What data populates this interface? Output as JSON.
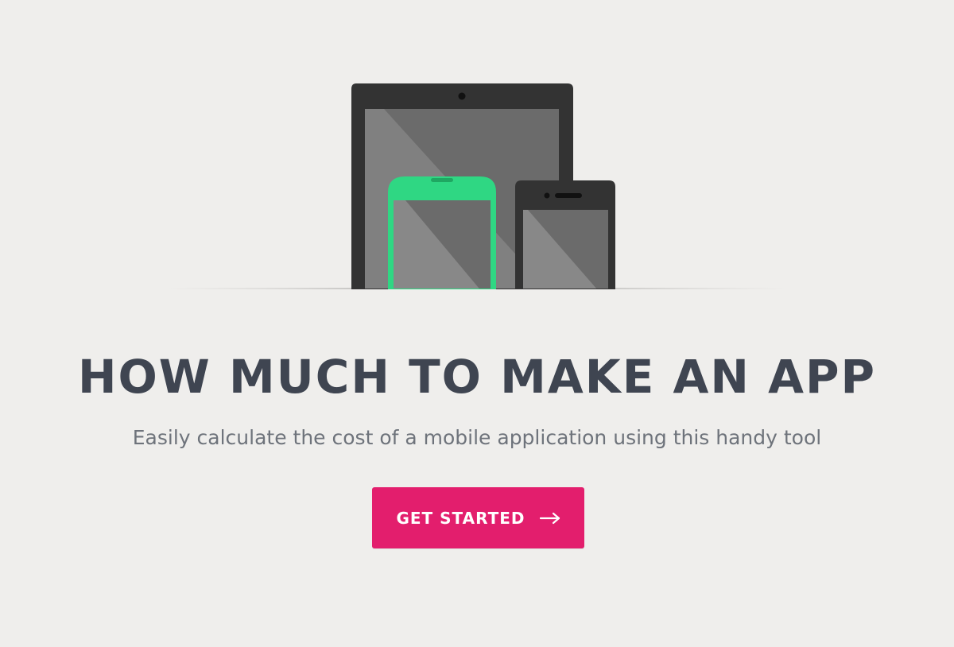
{
  "hero": {
    "title": "HOW MUCH TO MAKE AN APP",
    "subtitle": "Easily calculate the cost of a mobile application using this handy tool",
    "cta_label": "GET STARTED",
    "cta_icon": "arrow-right-icon"
  },
  "illustration": {
    "devices": [
      "tablet",
      "android-phone",
      "iphone"
    ]
  },
  "colors": {
    "background": "#efeeec",
    "title": "#3f4551",
    "subtitle": "#6e737b",
    "cta_background": "#e31e6d",
    "device_body": "#333333",
    "device_screen": "#6b6b6b",
    "device_screen_highlight": "#888888",
    "android_accent": "#2fd783"
  }
}
